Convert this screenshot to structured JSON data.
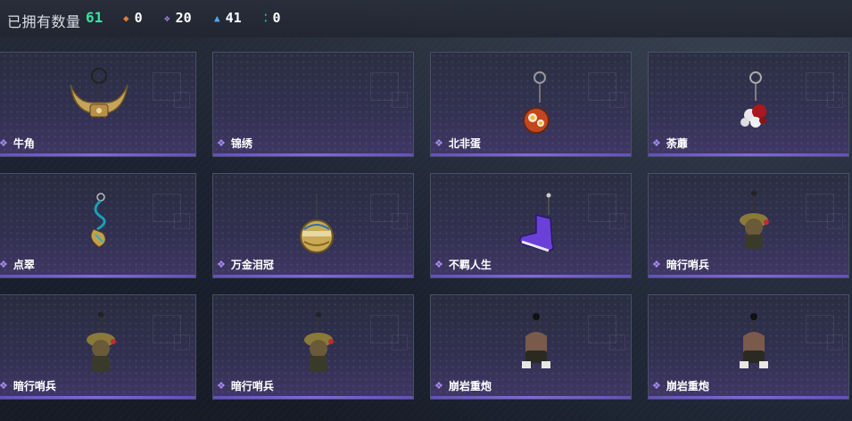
{
  "header": {
    "owned_label": "已拥有数量",
    "owned_count": "61",
    "stats": [
      {
        "icon": "orange-gem-icon",
        "color": "#e07a3a",
        "value": "0"
      },
      {
        "icon": "purple-gem-icon",
        "color": "#9b7fe8",
        "value": "20"
      },
      {
        "icon": "blue-gem-icon",
        "color": "#5aa5e8",
        "value": "41"
      },
      {
        "icon": "teal-gem-icon",
        "color": "#39c9b8",
        "value": "0"
      }
    ]
  },
  "items": [
    {
      "name": "牛角",
      "art": "bull-horn-charm-icon"
    },
    {
      "name": "锦绣",
      "art": ""
    },
    {
      "name": "北非蛋",
      "art": "shakshuka-pan-charm-icon"
    },
    {
      "name": "荼蘼",
      "art": "flower-charm-icon"
    },
    {
      "name": "点翠",
      "art": "phoenix-hairpin-charm-icon"
    },
    {
      "name": "万金泪冠",
      "art": "golden-crown-charm-icon"
    },
    {
      "name": "不羁人生",
      "art": "purple-sneaker-charm-icon"
    },
    {
      "name": "暗行哨兵",
      "art": "sentinel-figure-charm-icon"
    },
    {
      "name": "暗行哨兵",
      "art": "sentinel-figure-charm-icon"
    },
    {
      "name": "暗行哨兵",
      "art": "sentinel-figure-charm-icon"
    },
    {
      "name": "崩岩重炮",
      "art": "heavy-gunner-figure-charm-icon"
    },
    {
      "name": "崩岩重炮",
      "art": "heavy-gunner-figure-charm-icon"
    }
  ],
  "colors": {
    "accent_green": "#3fe0a0",
    "rarity_purple": "#a98cf2"
  }
}
